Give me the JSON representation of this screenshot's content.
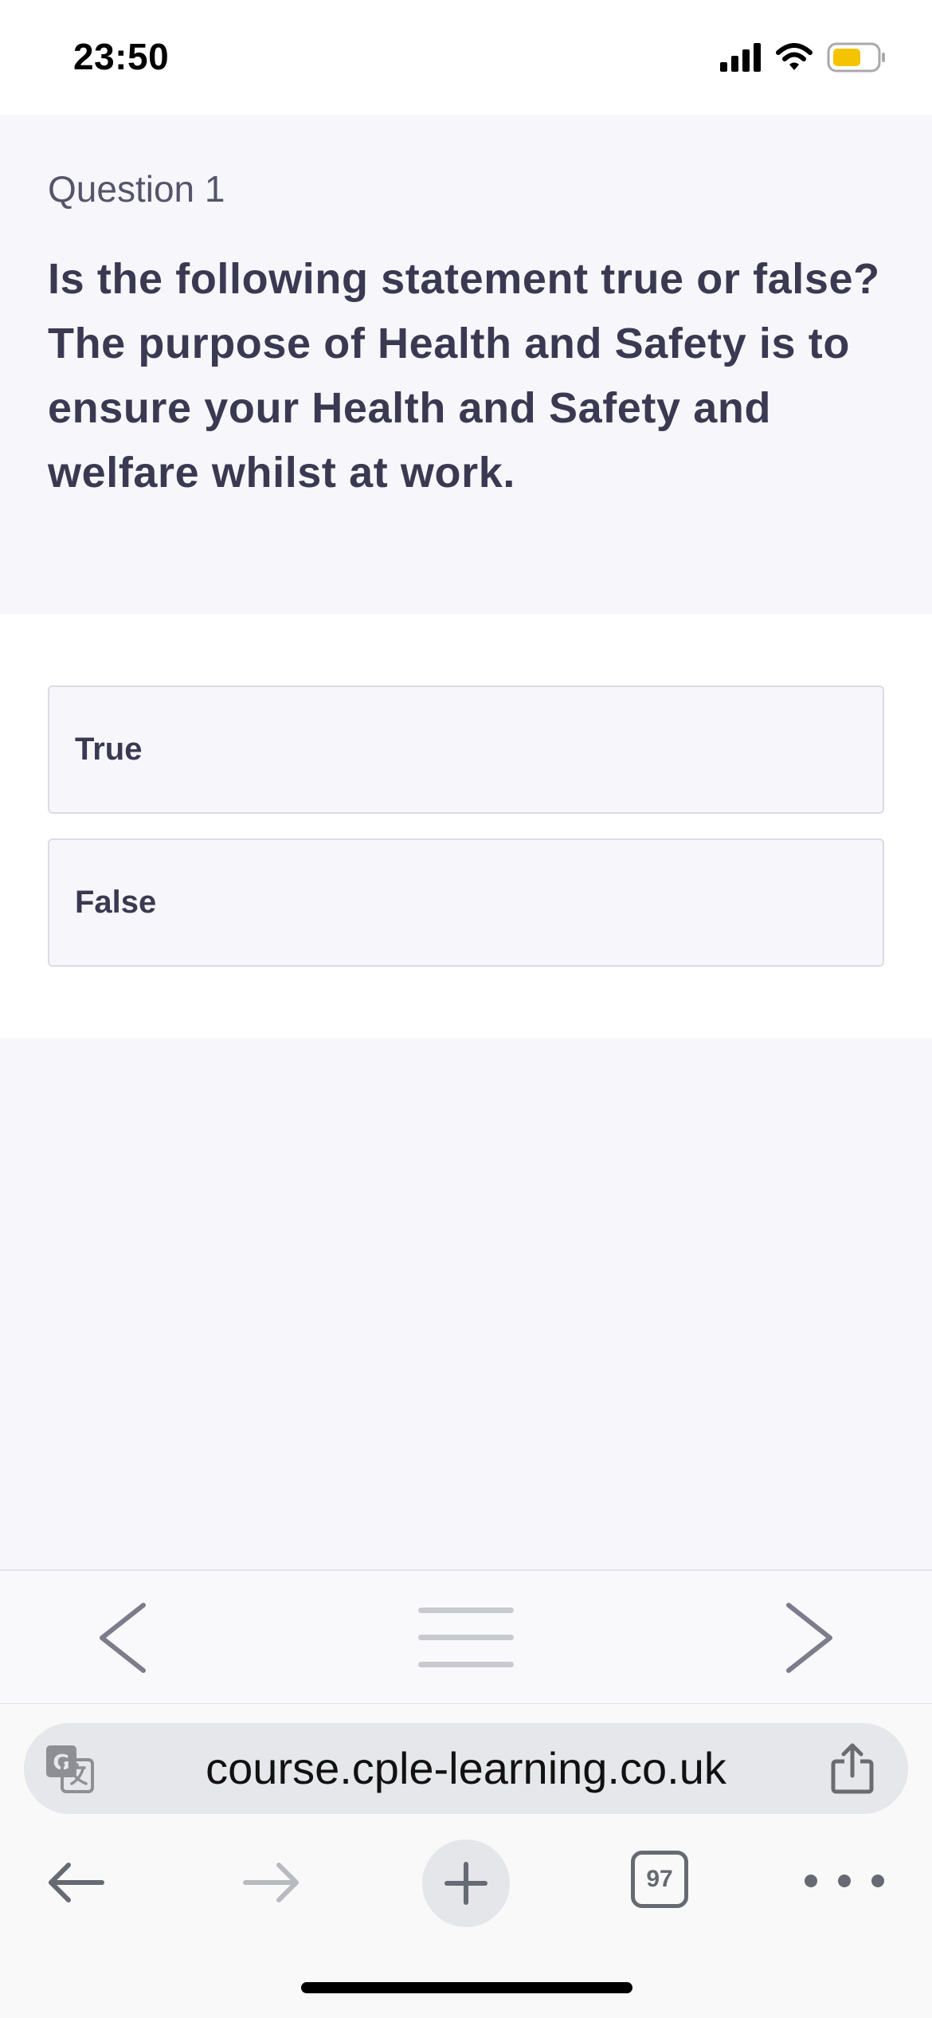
{
  "status_bar": {
    "time": "23:50",
    "signal_icon": "cellular-signal-icon",
    "wifi_icon": "wifi-icon",
    "battery_icon": "battery-icon",
    "battery_color": "#f5c400"
  },
  "question": {
    "number_label": "Question 1",
    "text": "Is the following statement true or false? The purpose of Health and Safety is to ensure your Health and Safety and welfare whilst at work."
  },
  "answers": [
    {
      "label": "True"
    },
    {
      "label": "False"
    }
  ],
  "lesson_nav": {
    "prev_icon": "chevron-left-icon",
    "menu_icon": "menu-icon",
    "next_icon": "chevron-right-icon"
  },
  "browser": {
    "url": "course.cple-learning.co.uk",
    "tab_count": "97",
    "translate_icon": "translate-icon",
    "share_icon": "share-icon",
    "back_icon": "back-arrow-icon",
    "forward_icon": "forward-arrow-icon",
    "new_tab_icon": "plus-icon",
    "more_icon": "more-icon"
  },
  "colors": {
    "text_primary": "#3b3952",
    "panel_bg": "#f7f7fb",
    "option_border": "#dcdbe7"
  }
}
